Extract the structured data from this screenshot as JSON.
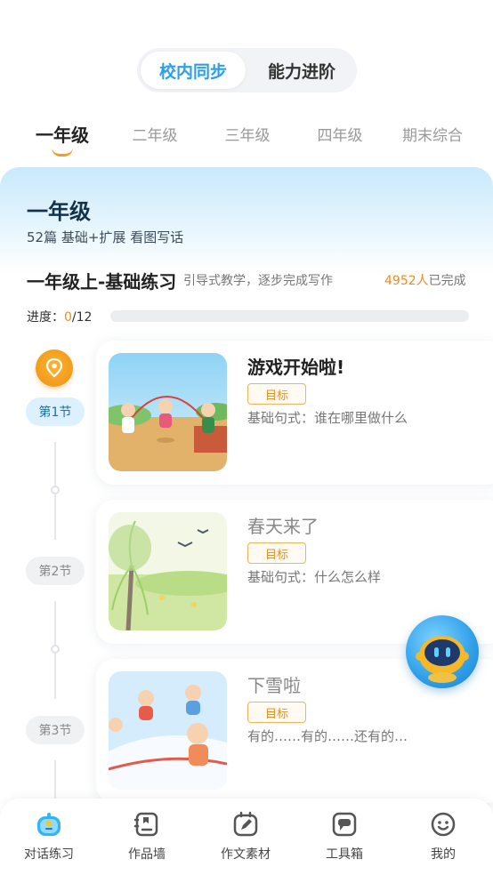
{
  "segment": {
    "active": "校内同步",
    "inactive": "能力进阶"
  },
  "grade_tabs": [
    "一年级",
    "二年级",
    "三年级",
    "四年级",
    "期末综合"
  ],
  "grade": {
    "title": "一年级",
    "subtitle": "52篇 基础+扩展 看图写话"
  },
  "course": {
    "title": "一年级上-基础练习",
    "desc": "引导式教学，逐步完成写作",
    "completed_count": "4952人",
    "completed_suffix": "已完成"
  },
  "progress": {
    "label": "进度：",
    "current": "0",
    "total": "/12",
    "fraction": 0
  },
  "sections": [
    {
      "pill": "第1节",
      "title": "游戏开始啦!",
      "tag": "目标",
      "pattern": "基础句式：谁在哪里做什么"
    },
    {
      "pill": "第2节",
      "title": "春天来了",
      "tag": "目标",
      "pattern": "基础句式：什么怎么样"
    },
    {
      "pill": "第3节",
      "title": "下雪啦",
      "tag": "目标",
      "pattern": "有的……有的……还有的…"
    }
  ],
  "nav": [
    {
      "label": "对话练习",
      "icon": "chat-robot-icon"
    },
    {
      "label": "作品墙",
      "icon": "works-wall-icon"
    },
    {
      "label": "作文素材",
      "icon": "pencil-note-icon"
    },
    {
      "label": "工具箱",
      "icon": "toolbox-icon"
    },
    {
      "label": "我的",
      "icon": "profile-face-icon"
    }
  ],
  "colors": {
    "accent_blue": "#2e9fe6",
    "accent_orange": "#f39a2b"
  }
}
